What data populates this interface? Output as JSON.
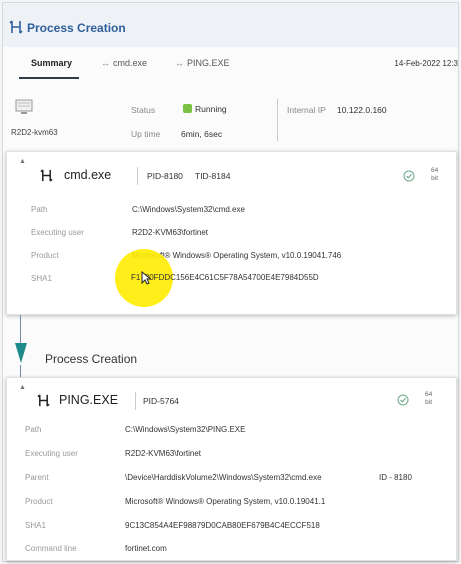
{
  "header": {
    "title": "Process Creation"
  },
  "tabs": [
    {
      "label": "Summary",
      "active": true
    },
    {
      "label": "cmd.exe",
      "active": false
    },
    {
      "label": "PING.EXE",
      "active": false
    }
  ],
  "date": "14-Feb-2022 12:3",
  "summary": {
    "host_name": "R2D2-kvm63",
    "status_label": "Status",
    "status_value": "Running",
    "status_color": "#7bc043",
    "uptime_label": "Up time",
    "uptime_value": "6min, 6sec",
    "internal_ip_label": "Internal IP",
    "internal_ip_value": "10.122.0.160"
  },
  "cmd_card": {
    "name": "cmd.exe",
    "pid": "PID-8180",
    "tid": "TID-8184",
    "bits": "64",
    "bits_unit": "bit",
    "rows": [
      {
        "label": "Path",
        "value": "C:\\Windows\\System32\\cmd.exe"
      },
      {
        "label": "Executing user",
        "value": "R2D2-KVM63\\fortinet"
      },
      {
        "label": "Product",
        "value": "Microsoft® Windows® Operating System, v10.0.19041.746"
      },
      {
        "label": "SHA1",
        "value": "F1  80FDDC156E4C61C5F78A54700E4E7984D55D"
      }
    ]
  },
  "connector": {
    "title": "Process Creation"
  },
  "ping_card": {
    "name": "PING.EXE",
    "pid": "PID-5764",
    "bits": "64",
    "bits_unit": "bit",
    "rows": [
      {
        "label": "Path",
        "value": "C:\\Windows\\System32\\PING.EXE"
      },
      {
        "label": "Executing user",
        "value": "R2D2-KVM63\\fortinet"
      },
      {
        "label": "Parent",
        "value": "\\Device\\HarddiskVolume2\\Windows\\System32\\cmd.exe"
      },
      {
        "label": "Product",
        "value": "Microsoft® Windows® Operating System, v10.0.19041.1"
      },
      {
        "label": "SHA1",
        "value": "9C13C854A4EF98879D0CAB80EF679B4C4ECCF518"
      },
      {
        "label": "Command line",
        "value": "fortinet.com"
      }
    ],
    "parent_id": "ID - 8180"
  },
  "icons": {
    "title": "process-tree-icon",
    "host": "computer-icon",
    "process": "process-tree-icon",
    "check": "check-circle-icon",
    "arrow": "down-arrow-icon"
  }
}
